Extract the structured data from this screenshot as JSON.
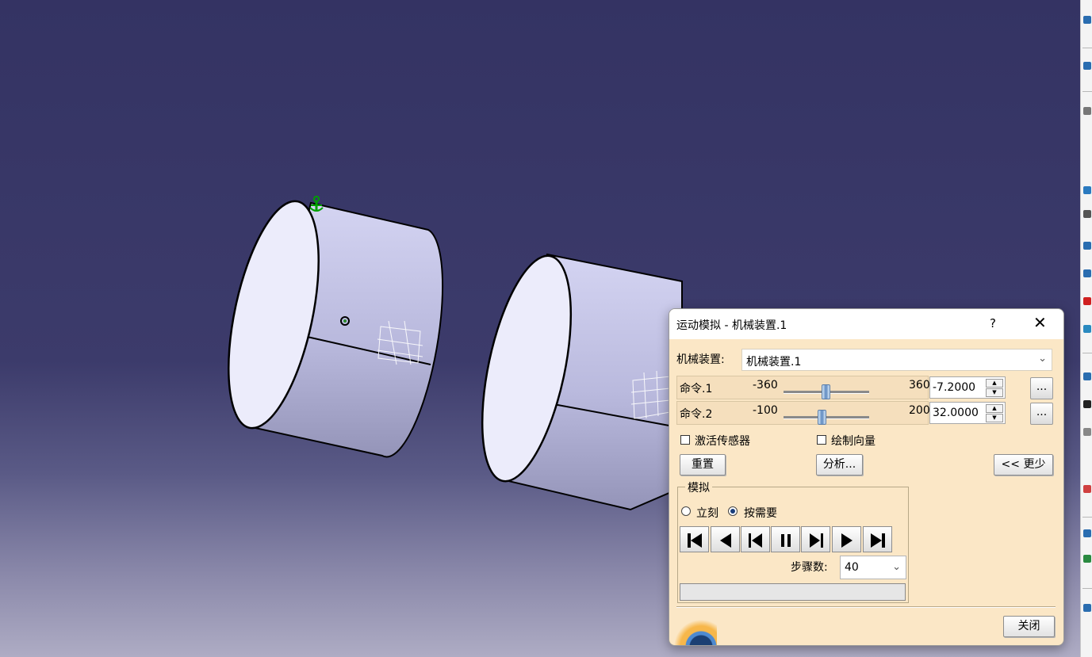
{
  "dialog": {
    "title": "运动模拟 - 机械装置.1",
    "help_label": "?",
    "close_icon_label": "✕",
    "mechanism_label": "机械装置:",
    "mechanism_value": "机械装置.1",
    "commands": [
      {
        "name": "命令.1",
        "min": "-360",
        "max": "360",
        "value": "-7.2000",
        "slider_fraction": 0.49,
        "more_label": "..."
      },
      {
        "name": "命令.2",
        "min": "-100",
        "max": "200",
        "value": "32.0000",
        "slider_fraction": 0.44,
        "more_label": "..."
      }
    ],
    "activate_sensors_label": "激活传感器",
    "draw_vectors_label": "绘制向量",
    "reset_label": "重置",
    "analysis_label": "分析...",
    "less_label": "<< 更少",
    "simulation": {
      "legend": "模拟",
      "immediate_label": "立刻",
      "on_request_label": "按需要",
      "selected_mode": "on_request",
      "steps_label": "步骤数:",
      "steps_value": "40",
      "progress_fraction": 0
    },
    "close_label": "关闭"
  },
  "colors": {
    "background_top": "#343363",
    "dialog_background": "#fbe7c6",
    "part_face": "#e6e6f8",
    "part_side": "#b4b4d6",
    "anchor_green": "#00a000"
  }
}
